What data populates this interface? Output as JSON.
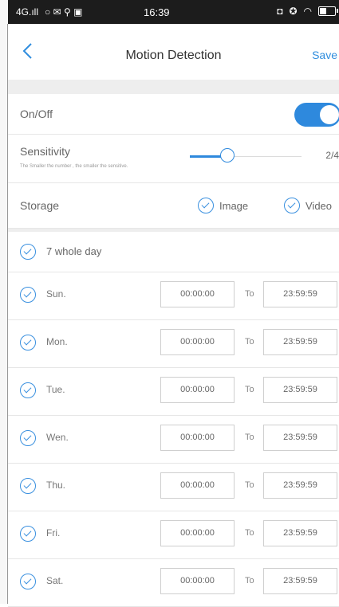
{
  "status_bar": {
    "signal": "4G.ıll",
    "time": "16:39"
  },
  "header": {
    "title": "Motion Detection",
    "save_label": "Save"
  },
  "onoff": {
    "label": "On/Off",
    "enabled": true
  },
  "sensitivity": {
    "label": "Sensitivity",
    "hint": "The Smaller the number , the smaller the sensitive.",
    "value_text": "2/4",
    "level": 2,
    "max": 4
  },
  "storage": {
    "label": "Storage",
    "image_label": "Image",
    "video_label": "Video"
  },
  "whole_day": {
    "label": "7 whole day"
  },
  "schedule": {
    "to_label": "To",
    "days": [
      {
        "name": "Sun.",
        "from": "00:00:00",
        "to": "23:59:59"
      },
      {
        "name": "Mon.",
        "from": "00:00:00",
        "to": "23:59:59"
      },
      {
        "name": "Tue.",
        "from": "00:00:00",
        "to": "23:59:59"
      },
      {
        "name": "Wen.",
        "from": "00:00:00",
        "to": "23:59:59"
      },
      {
        "name": "Thu.",
        "from": "00:00:00",
        "to": "23:59:59"
      },
      {
        "name": "Fri.",
        "from": "00:00:00",
        "to": "23:59:59"
      },
      {
        "name": "Sat.",
        "from": "00:00:00",
        "to": "23:59:59"
      }
    ]
  },
  "colors": {
    "accent": "#2e89dd",
    "status_bar": "#1c1c1c",
    "divider": "#e6e6e6"
  },
  "icons": [
    "back-chevron-icon",
    "check-circle-icon",
    "wifi-icon",
    "battery-icon"
  ]
}
